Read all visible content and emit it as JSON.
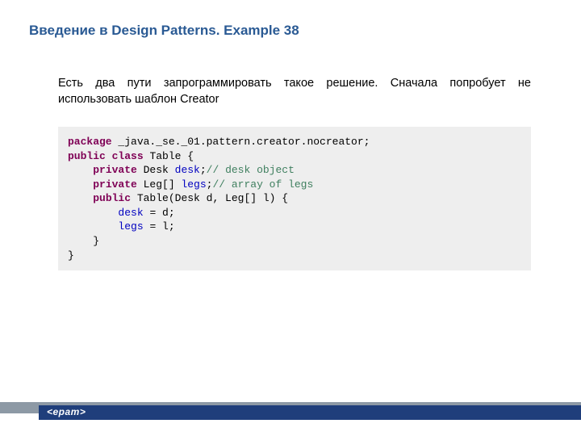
{
  "title": "Введение в Design Patterns. Example 38",
  "body": "Есть два пути запрограммировать такое решение. Сначала попробует не использовать шаблон Creator",
  "code": {
    "kw_package": "package",
    "pkg_name": " _java._se._01.pattern.creator.nocreator;",
    "kw_public": "public",
    "kw_class": "class",
    "cls_name": " Table {",
    "kw_private1": "private",
    "type_desk": " Desk ",
    "fld_desk": "desk",
    "semi1": ";",
    "cm_desk": "// desk object",
    "kw_private2": "private",
    "type_leg": " Leg[] ",
    "fld_legs": "legs",
    "semi2": ";",
    "cm_legs": "// array of legs",
    "kw_public2": "public",
    "ctor_sig": " Table(Desk d, Leg[] l) {",
    "fld_desk2": "desk",
    "assign_d": " = d;",
    "fld_legs2": "legs",
    "assign_l": " = l;",
    "close_ctor": "    }",
    "close_cls": "}"
  },
  "footer": {
    "logo": "<epam>"
  }
}
